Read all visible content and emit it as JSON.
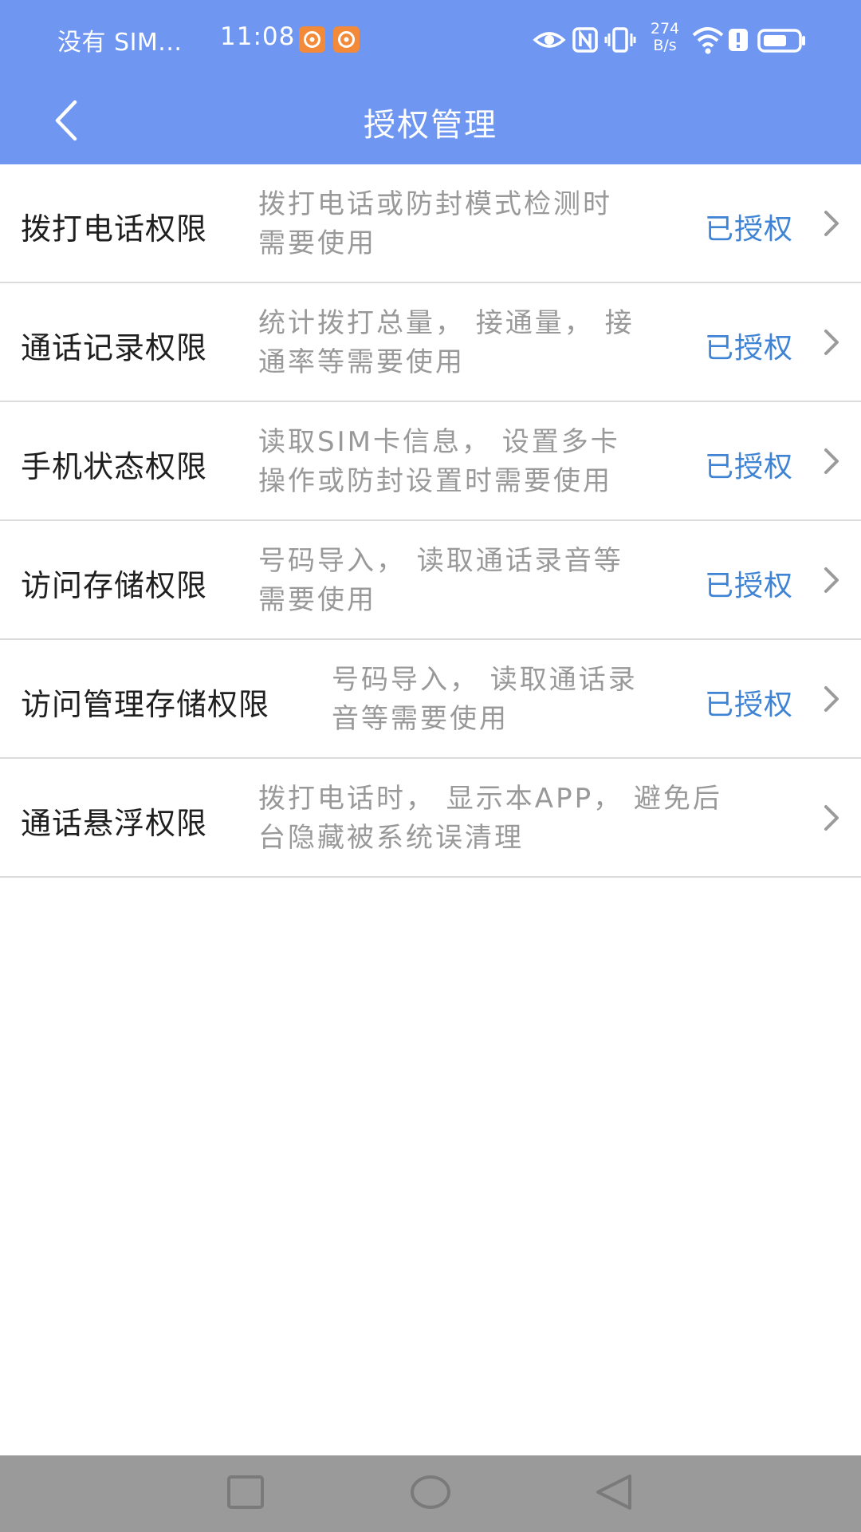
{
  "status_bar": {
    "carrier": "没有 SIM...",
    "time": "11:08",
    "net_speed_value": "274",
    "net_speed_unit": "B/s"
  },
  "header": {
    "title": "授权管理"
  },
  "permissions": [
    {
      "name": "拨打电话权限",
      "desc_line1": "拨打电话或防封模式检测时",
      "desc_line2": "需要使用",
      "status": "已授权"
    },
    {
      "name": "通话记录权限",
      "desc_line1": "统计拨打总量， 接通量， 接",
      "desc_line2": "通率等需要使用",
      "status": "已授权"
    },
    {
      "name": "手机状态权限",
      "desc_line1": "读取SIM卡信息， 设置多卡",
      "desc_line2": "操作或防封设置时需要使用",
      "status": "已授权"
    },
    {
      "name": "访问存储权限",
      "desc_line1": "号码导入， 读取通话录音等",
      "desc_line2": "需要使用",
      "status": "已授权"
    },
    {
      "name": "访问管理存储权限",
      "desc_line1": "号码导入， 读取通话录",
      "desc_line2": "音等需要使用",
      "status": "已授权"
    },
    {
      "name": "通话悬浮权限",
      "desc_line1": "拨打电话时， 显示本APP， 避免后",
      "desc_line2": "台隐藏被系统误清理",
      "status": ""
    }
  ],
  "colors": {
    "header_bg": "#6f97f2",
    "status_granted": "#3f84d4",
    "desc_text": "#999999",
    "divider": "#dcdcdc",
    "system_nav_bg": "#9a9a9a"
  },
  "icons": {
    "back": "chevron-left-icon",
    "row_arrow": "chevron-right-icon",
    "system_nav": [
      "recent-apps-square-icon",
      "home-circle-icon",
      "back-triangle-icon"
    ]
  }
}
